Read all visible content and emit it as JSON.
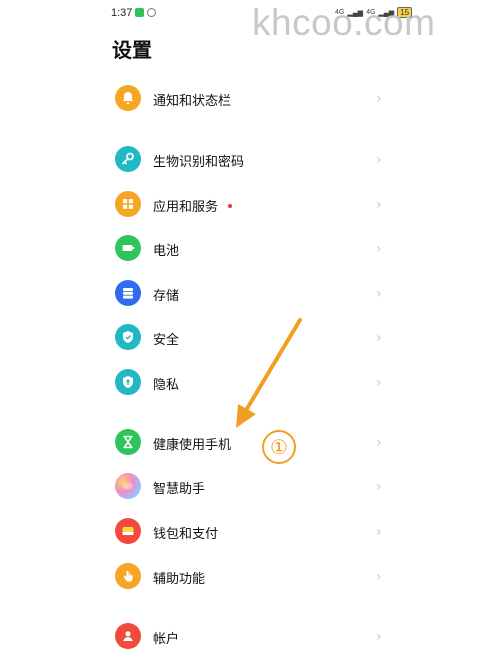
{
  "status_bar": {
    "time": "1:37",
    "signal_1": "4G",
    "signal_2": "4G",
    "battery": "15"
  },
  "watermark": "khcoo.com",
  "page": {
    "title": "设置"
  },
  "settings": {
    "items": [
      {
        "label": "通知和状态栏",
        "icon": "bell-icon",
        "color": "#f5a623"
      },
      {
        "label": "生物识别和密码",
        "icon": "key-icon",
        "color": "#1fb8c4"
      },
      {
        "label": "应用和服务",
        "icon": "apps-icon",
        "color": "#f5a623",
        "badge": "new-dot"
      },
      {
        "label": "电池",
        "icon": "battery-icon",
        "color": "#2ec45c"
      },
      {
        "label": "存储",
        "icon": "storage-icon",
        "color": "#2f6df0"
      },
      {
        "label": "安全",
        "icon": "shield-icon",
        "color": "#1fb8c4"
      },
      {
        "label": "隐私",
        "icon": "privacy-shield-icon",
        "color": "#1fb8c4"
      },
      {
        "label": "健康使用手机",
        "icon": "hourglass-icon",
        "color": "#2ec45c"
      },
      {
        "label": "智慧助手",
        "icon": "assistant-icon",
        "color": "#d48ee6"
      },
      {
        "label": "钱包和支付",
        "icon": "wallet-icon",
        "color": "#f24a3c"
      },
      {
        "label": "辅助功能",
        "icon": "hand-icon",
        "color": "#f5a623"
      },
      {
        "label": "帐户",
        "icon": "person-icon",
        "color": "#f24a3c"
      }
    ],
    "chevron": "›"
  },
  "annotation": {
    "step_label": "①",
    "arrow_color": "#f0a020"
  }
}
